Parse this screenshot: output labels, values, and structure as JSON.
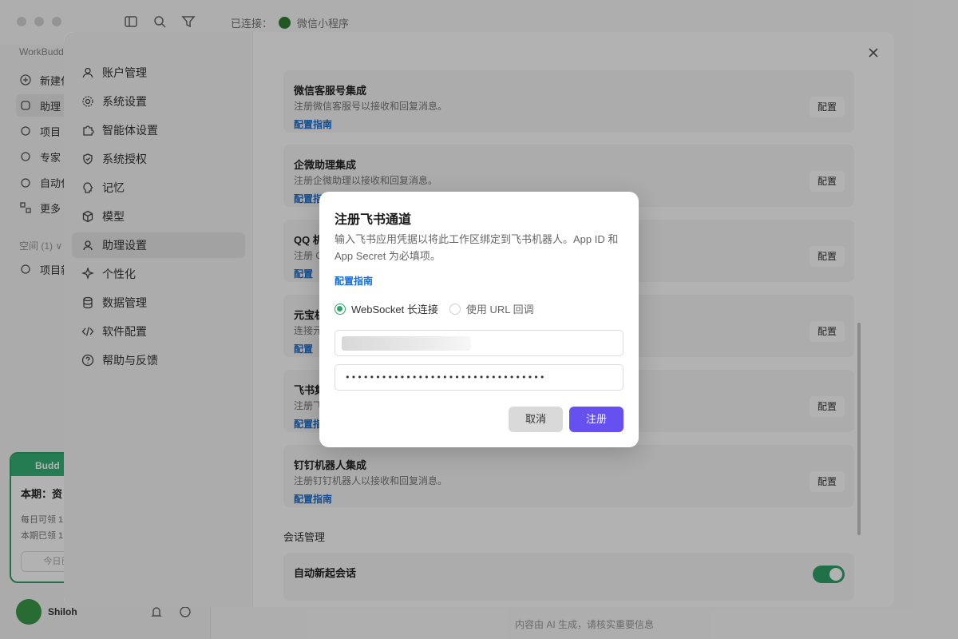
{
  "app": {
    "brand": "WorkBudd",
    "connection_label": "已连接：",
    "connection_target": "微信小程序",
    "sidebar_items": [
      {
        "label": "新建任"
      },
      {
        "label": "助理"
      },
      {
        "label": "项目"
      },
      {
        "label": "专家"
      },
      {
        "label": "自动化"
      },
      {
        "label": "更多"
      }
    ],
    "space_label": "空间 (1) ∨",
    "space_item": "项目新",
    "promo": {
      "header": "Budd",
      "title": "本期：资",
      "line1": "每日可领 1",
      "line2": "本期已领 1",
      "button": "今日已"
    },
    "username": "Shiloh",
    "footer_note": "内容由 AI 生成，请核实重要信息"
  },
  "settings": {
    "nav": [
      {
        "label": "账户管理",
        "icon": "user-icon"
      },
      {
        "label": "系统设置",
        "icon": "gear-icon"
      },
      {
        "label": "智能体设置",
        "icon": "puzzle-icon"
      },
      {
        "label": "系统授权",
        "icon": "shield-icon"
      },
      {
        "label": "记忆",
        "icon": "brain-icon"
      },
      {
        "label": "模型",
        "icon": "cube-icon"
      },
      {
        "label": "助理设置",
        "icon": "assistant-icon"
      },
      {
        "label": "个性化",
        "icon": "sparkle-icon"
      },
      {
        "label": "数据管理",
        "icon": "database-icon"
      },
      {
        "label": "软件配置",
        "icon": "code-icon"
      },
      {
        "label": "帮助与反馈",
        "icon": "help-icon"
      }
    ],
    "cards": [
      {
        "title": "微信客服号集成",
        "desc": "注册微信客服号以接收和回复消息。",
        "link": "配置指南",
        "button": "配置"
      },
      {
        "title": "企微助理集成",
        "desc": "注册企微助理以接收和回复消息。",
        "link": "配置指南",
        "button": "配置"
      },
      {
        "title": "QQ 机",
        "desc": "注册 Q",
        "link": "配置",
        "button": "配置"
      },
      {
        "title": "元宝机",
        "desc": "连接元",
        "link": "配置",
        "button": "配置"
      },
      {
        "title": "飞书集",
        "desc": "注册飞",
        "link": "配置指",
        "button": "配置"
      },
      {
        "title": "钉钉机器人集成",
        "desc": "注册钉钉机器人以接收和回复消息。",
        "link": "配置指南",
        "button": "配置"
      }
    ],
    "session_section": "会话管理",
    "session_card_title": "自动新起会话"
  },
  "modal": {
    "title": "注册飞书通道",
    "description": "输入飞书应用凭据以将此工作区绑定到飞书机器人。App ID 和 App Secret 为必填项。",
    "guide_link": "配置指南",
    "mode_options": [
      {
        "label": "WebSocket 长连接",
        "selected": true
      },
      {
        "label": "使用 URL 回调",
        "selected": false
      }
    ],
    "app_secret_masked": "•••••••••••••••••••••••••••••••••",
    "cancel_label": "取消",
    "register_label": "注册",
    "accent_color": "#6650ef",
    "radio_color": "#2ea36b"
  }
}
